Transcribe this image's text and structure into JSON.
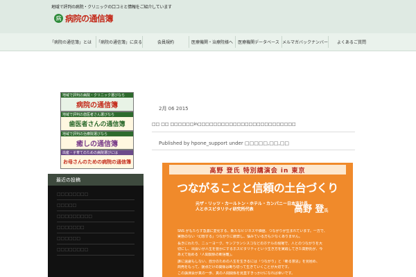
{
  "header": {
    "tagline": "地域で評判の病院・クリニックの口コミと情報をご紹介しています",
    "logo_text": "病院の通信簿",
    "logo_mark": "病"
  },
  "nav": {
    "items": [
      {
        "label": "「病院の通信簿」とは"
      },
      {
        "label": "「病院の通信簿」に戻る"
      },
      {
        "label": "会員規約"
      },
      {
        "label": "医療機関・治療院様へ"
      },
      {
        "label": "医療機関データベース"
      },
      {
        "label": "メルマガバックナンバー"
      },
      {
        "label": "よくあるご質問"
      }
    ]
  },
  "banners": [
    {
      "caption": "地域で評判の病院・クリニック選びなら",
      "title": "病院の通信簿",
      "cap_color": "#2e6b2e"
    },
    {
      "caption": "地域で評判の歯医者さん選びなら",
      "title": "歯医者さんの通信簿",
      "cap_color": "#2e6b2e"
    },
    {
      "caption": "地域で評判の治療院選びなら",
      "title": "癒しの通信簿",
      "cap_color": "#2e6b2e"
    },
    {
      "caption": "出産・子育てのための病院選びには",
      "title": "お母さんのための病院の通信簿",
      "cap_color": "#6b4a8a"
    }
  ],
  "sidebar": {
    "title": "最近の投稿",
    "items": [
      {
        "label": "□□□□□□□□"
      },
      {
        "label": "□□□□□"
      },
      {
        "label": "□□□□□□□□□"
      },
      {
        "label": "□□□□□□□"
      },
      {
        "label": "□□□□□□"
      },
      {
        "label": "□□□□□□□□"
      }
    ]
  },
  "post": {
    "date": "2月 06 2015",
    "title": "□□ □□ □□□□□□in□□□□□□□□□□□□□□□□□□□□□□□□□",
    "meta": "Published by hpone_support under □□□□□,□□,□□"
  },
  "poster": {
    "ribbon": "高野 登氏 特別講演会 in 東京",
    "title": "つながることと信頼の土台づくり",
    "sub1": "元ザ・リッツ・カールトン・ホテル・カンパニー日本支社長",
    "sub2": "人とホスピタリティ研究所代表",
    "speaker": "高野 登",
    "speaker_suffix": "氏",
    "body": [
      "SNS がもたらす急激に変化する、新たなビジネスや価値、つながりが生まれています。一方で、",
      "実態のない「幻想する」つながりに疲弊し、悩みている方も少なくありません。",
      "長きにわたり、ニューヨーク、サンフランシスコなどのホテルの現場で、人とのつながりを大",
      "切にし、出会いが人生を豊かにするホスピタリティという生き方を実践してきた高野氏が、今",
      "あえて始める「人間関係の断捨離」。",
      "誰に遠慮もしない、自分のための人生を生きるには「つながり」と「断る意思」を見極め、",
      "商売をもって、援点だけの関係は断ち切って生きていくことが大切です。",
      "この講演会が真の一歩、真の人間関係を見直すきっかけになれば幸いです。"
    ]
  },
  "colors": {
    "accent_red": "#c42c1c",
    "brand_green": "#2e8b3a",
    "poster_orange": "#f08a2b"
  }
}
